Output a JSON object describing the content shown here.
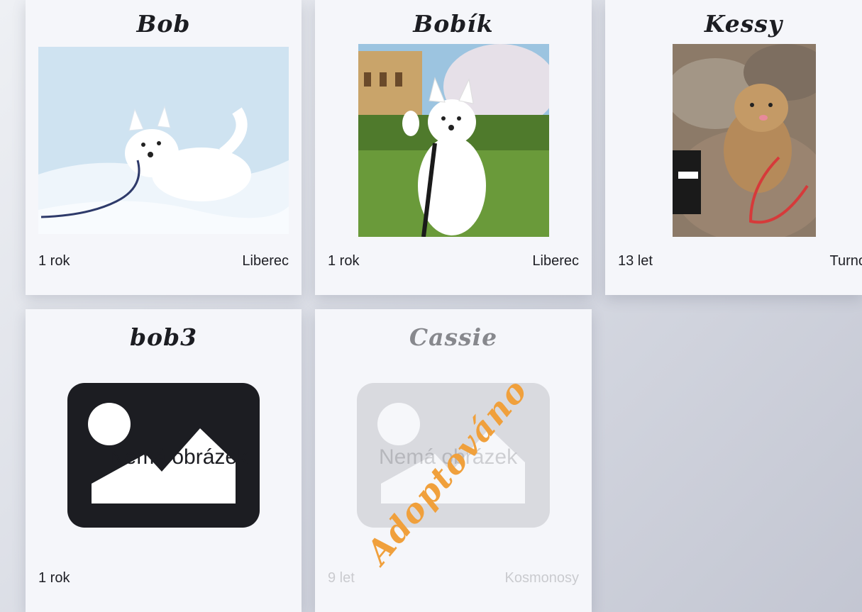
{
  "colors": {
    "accent_stamp": "#f0a03c",
    "card_bg": "#f5f6fa",
    "text": "#1c1d22"
  },
  "cards": [
    {
      "name": "Bob",
      "age": "1 rok",
      "city": "Liberec"
    },
    {
      "name": "Bobík",
      "age": "1 rok",
      "city": "Liberec"
    },
    {
      "name": "Kessy",
      "age": "13 let",
      "city": "Turno"
    },
    {
      "name": "bob3",
      "age": "1 rok",
      "city": "",
      "no_image_text": "Nemá obrázek",
      "icon": "image-placeholder-icon"
    },
    {
      "name": "Cassie",
      "age": "9 let",
      "city": "Kosmonosy",
      "no_image_text": "Nemá obrázek",
      "icon": "image-placeholder-icon",
      "status": "Adoptováno"
    }
  ]
}
